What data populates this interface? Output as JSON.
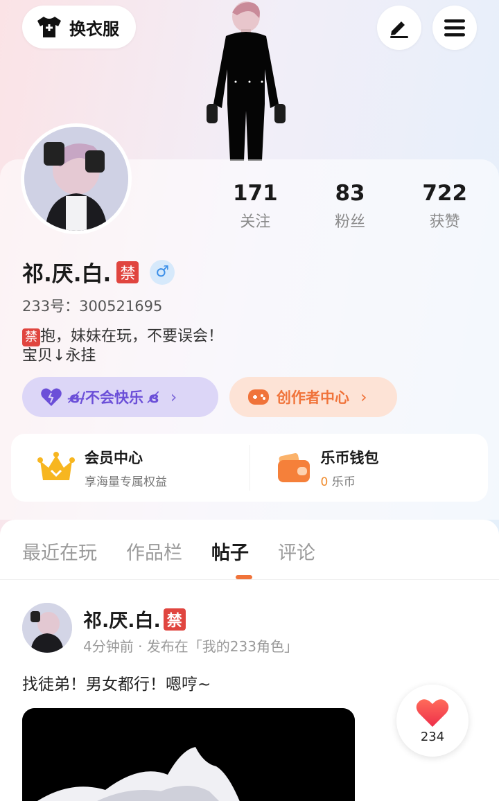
{
  "header": {
    "outfit_label": "换衣服",
    "edit_icon": "pen-icon",
    "menu_icon": "hamburger-menu-icon"
  },
  "stats": [
    {
      "num": "171",
      "label": "关注"
    },
    {
      "num": "83",
      "label": "粉丝"
    },
    {
      "num": "722",
      "label": "获赞"
    }
  ],
  "profile": {
    "name": "祁.厌.白.",
    "ban_badge": "禁",
    "gender": "♂",
    "id_line": "233号：300521695",
    "bio_line1": "抱，妹妹在玩，不要误会！",
    "bio_line2": "宝贝↓永挂"
  },
  "pills": {
    "status_text": "ɞ̸̶/̶不会快乐 ɞ̸",
    "creator_text": "创作者中心",
    "chevron": "›"
  },
  "wallet": {
    "vip_title": "会员中心",
    "vip_sub": "享海量专属权益",
    "coin_title": "乐币钱包",
    "coin_value": "0",
    "coin_unit": " 乐币"
  },
  "tabs": [
    "最近在玩",
    "作品栏",
    "帖子",
    "评论"
  ],
  "active_tab": 2,
  "post": {
    "author": "祁.厌.白.",
    "ban_badge": "禁",
    "meta": "4分钟前 · 发布在「我的233角色」",
    "text": "找徒弟！男女都行！嗯哼~",
    "likes": "234"
  },
  "colors": {
    "accent_orange": "#f0733a",
    "purple": "#6b4fd8",
    "ban_red": "#e0453f"
  }
}
